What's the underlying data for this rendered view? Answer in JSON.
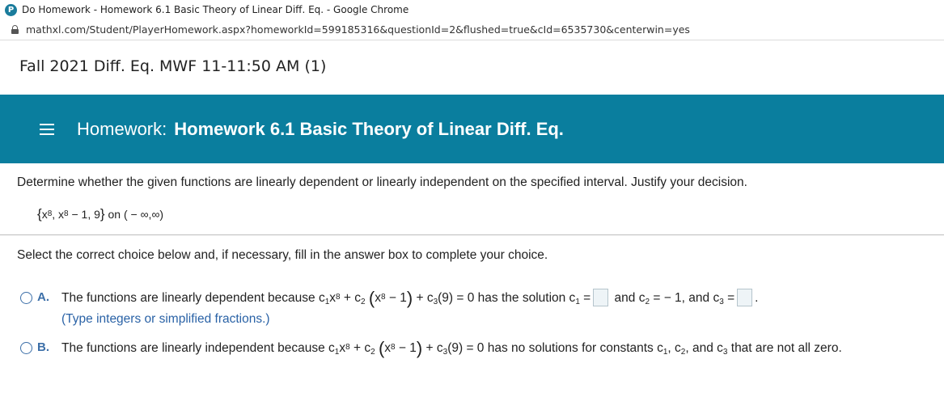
{
  "window": {
    "title": "Do Homework - Homework 6.1 Basic Theory of Linear Diff. Eq. - Google Chrome",
    "logo_letter": "P",
    "url": "mathxl.com/Student/PlayerHomework.aspx?homeworkId=599185316&questionId=2&flushed=true&cId=6535730&centerwin=yes"
  },
  "course": {
    "title": "Fall 2021 Diff. Eq. MWF 11-11:50 AM (1)"
  },
  "banner": {
    "prefix": "Homework:",
    "name": "Homework 6.1 Basic Theory of Linear Diff. Eq."
  },
  "question": {
    "prompt": "Determine whether the given functions are linearly dependent or linearly independent on the specified interval. Justify your decision.",
    "functions": {
      "open": "{",
      "x1": "x",
      "e1": "8",
      "sep1": ", ",
      "x2": "x",
      "e2": "8",
      "rest": " − 1, 9",
      "close": "}",
      "on": " on ",
      "interval": "( − ∞,∞)"
    }
  },
  "instruction": "Select the correct choice below and, if necessary, fill in the answer box to complete your choice.",
  "options": {
    "a": {
      "letter": "A.",
      "text1": "The functions are linearly dependent because c",
      "s1": "1",
      "x1": "x",
      "e1": "8",
      "t2": " + c",
      "s2": "2",
      "p_open": "(",
      "x2": "x",
      "e2": "8",
      "t3": " − 1",
      "p_close": ")",
      "t4": " + c",
      "s3": "3",
      "t5": "(9) = 0 has the solution c",
      "s4": "1",
      "t6": " =",
      "t7": "and c",
      "s5": "2",
      "t8": " = − 1, and c",
      "s6": "3",
      "t9": " =",
      "t10": ".",
      "hint": "(Type integers or simplified fractions.)"
    },
    "b": {
      "letter": "B.",
      "text1": "The functions are linearly independent because c",
      "s1": "1",
      "x1": "x",
      "e1": "8",
      "t2": " + c",
      "s2": "2",
      "p_open": "(",
      "x2": "x",
      "e2": "8",
      "t3": " − 1",
      "p_close": ")",
      "t4": " + c",
      "s3": "3",
      "t5": "(9) = 0 has no solutions for constants c",
      "s4": "1",
      "t6": ", c",
      "s5": "2",
      "t7": ", and c",
      "s6": "3",
      "t8": " that are not all zero."
    }
  },
  "colors": {
    "banner": "#0a7e9e",
    "radio": "#3c6fa8",
    "hint": "#2a62a6"
  }
}
